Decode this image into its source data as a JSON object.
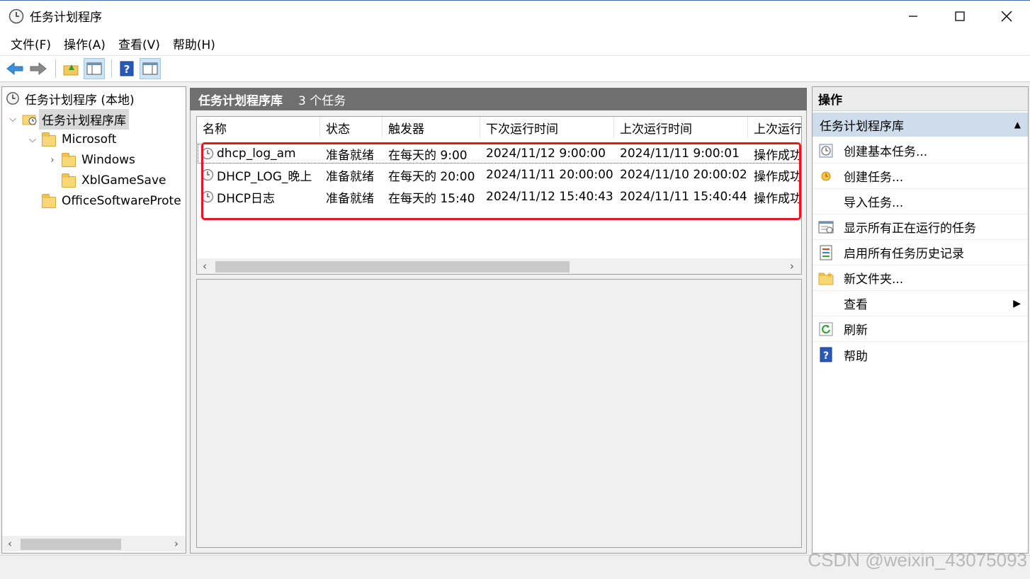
{
  "window": {
    "title": "任务计划程序",
    "minimize_icon": "minimize-icon",
    "maximize_icon": "maximize-icon",
    "close_icon": "close-icon"
  },
  "menu": [
    "文件(F)",
    "操作(A)",
    "查看(V)",
    "帮助(H)"
  ],
  "toolbar": [
    "back-arrow-icon",
    "forward-arrow-icon",
    "up-folder-icon",
    "show-hide-console-tree-icon",
    "help-icon",
    "show-hide-action-pane-icon"
  ],
  "tree": {
    "root": "任务计划程序 (本地)",
    "library": "任务计划程序库",
    "microsoft": "Microsoft",
    "windows": "Windows",
    "xbl": "XblGameSave",
    "office": "OfficeSoftwareProte"
  },
  "center": {
    "title": "任务计划程序库",
    "count": "3 个任务",
    "columns": [
      "名称",
      "状态",
      "触发器",
      "下次运行时间",
      "上次运行时间",
      "上次运行"
    ],
    "rows": [
      {
        "name": "dhcp_log_am",
        "status": "准备就绪",
        "trigger": "在每天的 9:00",
        "next": "2024/11/12 9:00:00",
        "last": "2024/11/11 9:00:01",
        "result": "操作成功"
      },
      {
        "name": "DHCP_LOG_晚上",
        "status": "准备就绪",
        "trigger": "在每天的 20:00",
        "next": "2024/11/11 20:00:00",
        "last": "2024/11/10 20:00:02",
        "result": "操作成功"
      },
      {
        "name": "DHCP日志",
        "status": "准备就绪",
        "trigger": "在每天的 15:40",
        "next": "2024/11/12 15:40:43",
        "last": "2024/11/11 15:40:44",
        "result": "操作成功"
      }
    ]
  },
  "actions": {
    "title": "操作",
    "section": "任务计划程序库",
    "items": [
      {
        "label": "创建基本任务...",
        "icon": "create-basic-task-icon"
      },
      {
        "label": "创建任务...",
        "icon": "create-task-icon"
      },
      {
        "label": "导入任务...",
        "icon": ""
      },
      {
        "label": "显示所有正在运行的任务",
        "icon": "running-tasks-icon"
      },
      {
        "label": "启用所有任务历史记录",
        "icon": "task-history-icon"
      },
      {
        "label": "新文件夹...",
        "icon": "new-folder-icon"
      },
      {
        "label": "查看",
        "icon": ""
      },
      {
        "label": "刷新",
        "icon": "refresh-icon"
      },
      {
        "label": "帮助",
        "icon": "help-icon"
      }
    ]
  },
  "watermark": "CSDN @weixin_43075093"
}
